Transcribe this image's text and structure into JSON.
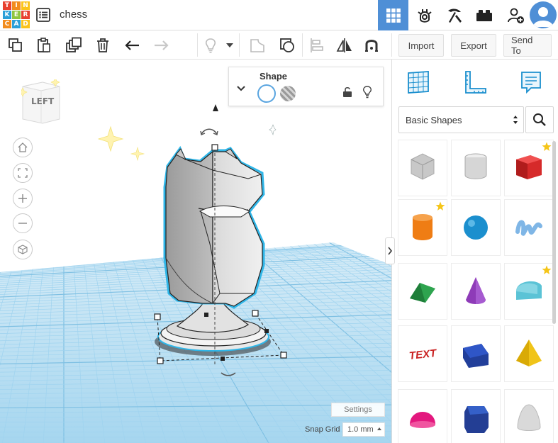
{
  "app": {
    "logo_letters": [
      "T",
      "I",
      "N",
      "K",
      "E",
      "R",
      "C",
      "A",
      "D"
    ],
    "logo_colors": [
      "#e8402f",
      "#f28c1e",
      "#fbc41b",
      "#2a9fd8",
      "#8fc63f",
      "#e8402f",
      "#f28c1e",
      "#2a9fd8",
      "#fbc41b"
    ],
    "design_title": "chess"
  },
  "topbar": {
    "items": [
      "3d-design-grid-icon",
      "circuits-icon",
      "minecraft-pickaxe-icon",
      "lego-brick-icon",
      "invite-user-icon"
    ],
    "active_color": "#4f8fd6"
  },
  "toolbar": {
    "import_label": "Import",
    "export_label": "Export",
    "send_to_label": "Send To"
  },
  "viewcube": {
    "face_label": "LEFT"
  },
  "shape_panel": {
    "title": "Shape",
    "solid_color": "#ffffff",
    "accent": "#5aa5e0"
  },
  "workplane": {
    "settings_label": "Settings",
    "snap_grid_label": "Snap Grid",
    "snap_grid_value": "1.0 mm",
    "grid_color": "#9fd3ef",
    "selection_outline": "#2fb6e8"
  },
  "right_panel": {
    "category": "Basic Shapes",
    "shapes": [
      {
        "name": "box-hole",
        "color": "#c8c8c8",
        "starred": false
      },
      {
        "name": "cylinder-hole",
        "color": "#d6d6d6",
        "starred": false
      },
      {
        "name": "box",
        "color": "#d62a2a",
        "starred": true
      },
      {
        "name": "cylinder",
        "color": "#ef7d14",
        "starred": true
      },
      {
        "name": "sphere",
        "color": "#1b8fce",
        "starred": false
      },
      {
        "name": "scribble",
        "color": "#7fb6e6",
        "starred": false
      },
      {
        "name": "roof",
        "color": "#2ea44f",
        "starred": false
      },
      {
        "name": "cone",
        "color": "#8e3bb8",
        "starred": false
      },
      {
        "name": "round-roof",
        "color": "#5bc3d6",
        "starred": true
      },
      {
        "name": "text",
        "color": "#c92020",
        "starred": false
      },
      {
        "name": "half-box",
        "color": "#223f9a",
        "starred": false
      },
      {
        "name": "pyramid",
        "color": "#f0c419",
        "starred": false
      },
      {
        "name": "half-sphere",
        "color": "#e3187e",
        "starred": false
      },
      {
        "name": "polygon",
        "color": "#233e94",
        "starred": false
      },
      {
        "name": "paraboloid",
        "color": "#d9d9d9",
        "starred": false
      }
    ],
    "text_shape_label": "TEXT"
  }
}
